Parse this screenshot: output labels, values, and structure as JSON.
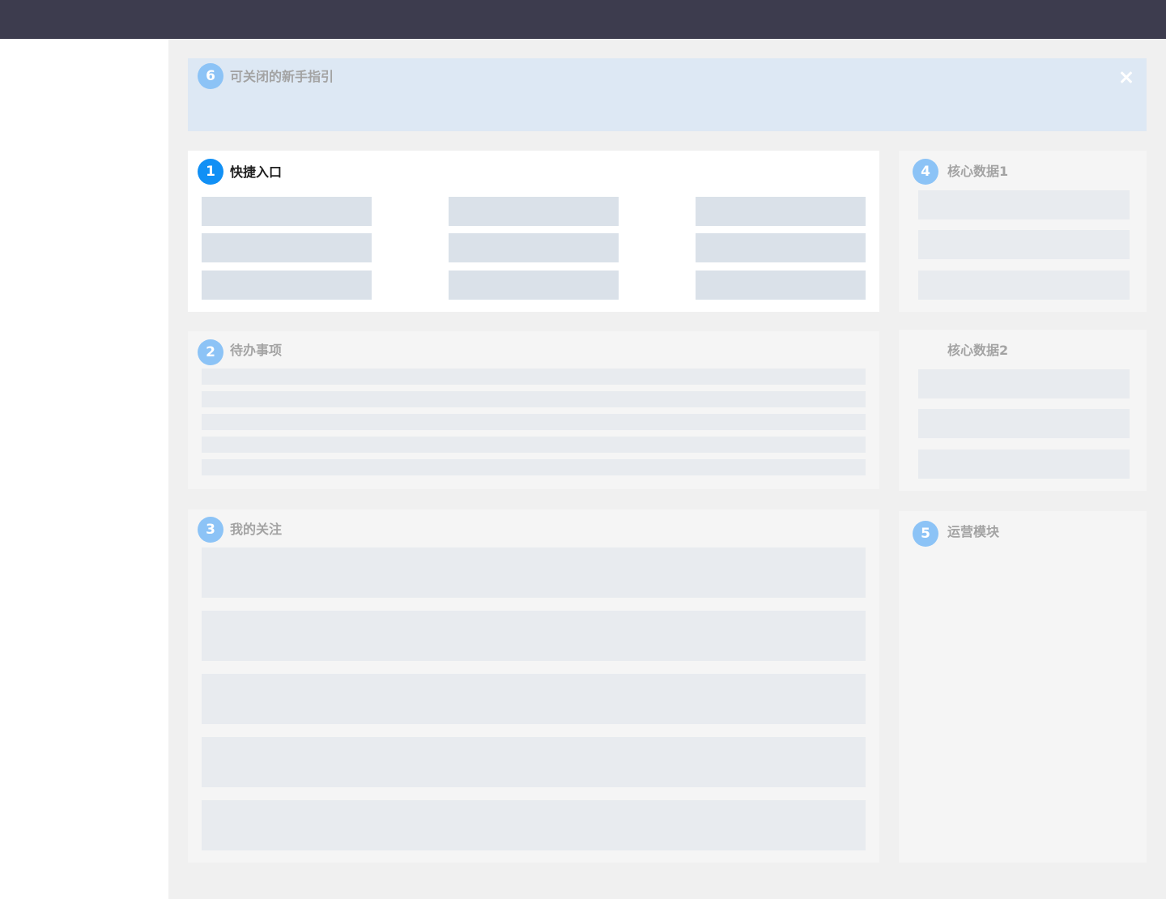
{
  "guide": {
    "badge": "6",
    "title": "可关闭的新手指引",
    "close_icon": "close-icon"
  },
  "quick_entry": {
    "badge": "1",
    "title": "快捷入口",
    "item_count": 9
  },
  "todo": {
    "badge": "2",
    "title": "待办事项",
    "item_count": 5
  },
  "follow": {
    "badge": "3",
    "title": "我的关注",
    "item_count": 5
  },
  "core_data_1": {
    "badge": "4",
    "title": "核心数据1",
    "item_count": 3
  },
  "core_data_2": {
    "title": "核心数据2",
    "item_count": 3
  },
  "operations": {
    "badge": "5",
    "title": "运营模块"
  },
  "colors": {
    "topbar": "#3d3c4e",
    "badge_active": "#1190f5",
    "badge_inactive": "#8cc3f6",
    "guide_background": "#dde8f4"
  }
}
